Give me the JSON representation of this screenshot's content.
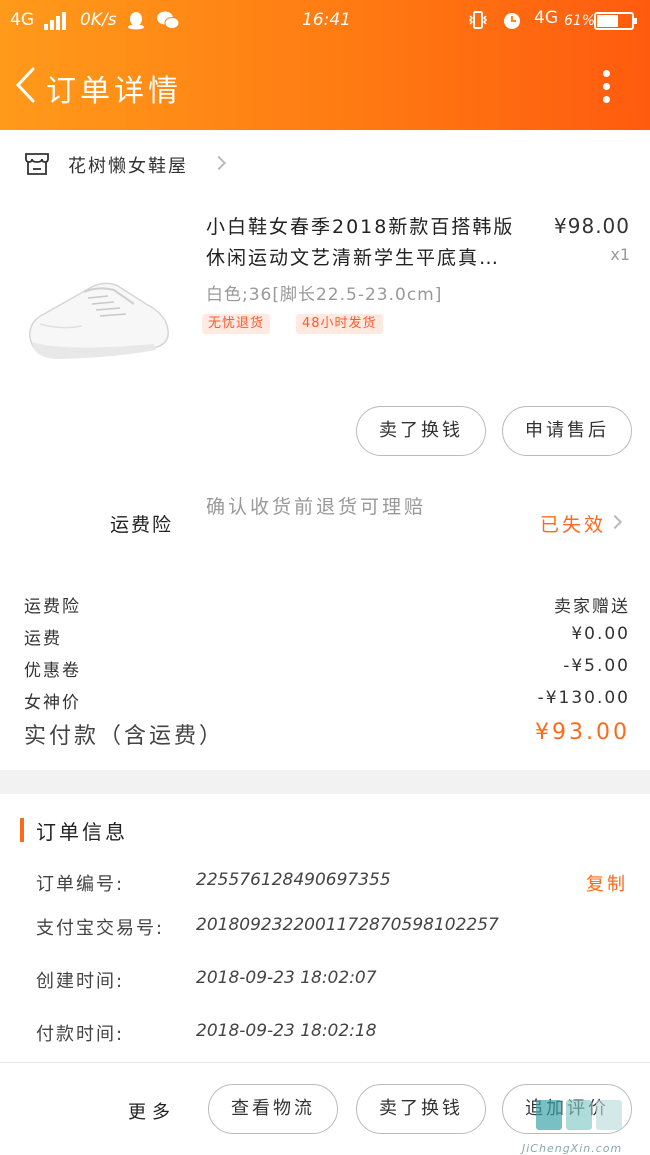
{
  "status_bar": {
    "network": "4G",
    "speed": "0K/s",
    "time": "16:41",
    "network_right": "4G",
    "battery": "61%",
    "battery_level": 0.61
  },
  "header": {
    "title": "订单详情",
    "gradient_from": "#ff9a1a",
    "gradient_to": "#ff5b0f"
  },
  "shop": {
    "name": "花树懒女鞋屋"
  },
  "product": {
    "title_line1": "小白鞋女春季2018新款百搭韩版",
    "title_line2": "休闲运动文艺清新学生平底真…",
    "price": "¥98.00",
    "qty": "x1",
    "sku": "白色;36[脚长22.5-23.0cm]",
    "tags": [
      "无忧退货",
      "48小时发货"
    ]
  },
  "item_actions": {
    "resell": "卖了换钱",
    "after_sale": "申请售后"
  },
  "insurance": {
    "title": "运费险",
    "description": "确认收货前退货可理赔",
    "status": "已失效"
  },
  "fees": [
    {
      "label": "运费险",
      "value": "卖家赠送"
    },
    {
      "label": "运费",
      "value": "¥0.00"
    },
    {
      "label": "优惠卷",
      "value": "-¥5.00"
    },
    {
      "label": "女神价",
      "value": "-¥130.00"
    }
  ],
  "total": {
    "label": "实付款（含运费）",
    "value": "¥93.00"
  },
  "order_info": {
    "section_title": "订单信息",
    "copy_label": "复制",
    "rows": [
      {
        "label": "订单编号:",
        "value": "225576128490697355"
      },
      {
        "label": "支付宝交易号:",
        "value": "2018092322001172870598102257"
      },
      {
        "label": "创建时间:",
        "value": "2018-09-23  18:02:07"
      },
      {
        "label": "付款时间:",
        "value": "2018-09-23  18:02:18"
      }
    ]
  },
  "bottom_bar": {
    "more": "更多",
    "logistics": "查看物流",
    "resell": "卖了换钱",
    "review": "追加评价"
  },
  "watermark": {
    "text": "JiChengXin.com"
  },
  "colors": {
    "accent": "#ff6a1a",
    "tag_bg": "#ffe9e0"
  }
}
